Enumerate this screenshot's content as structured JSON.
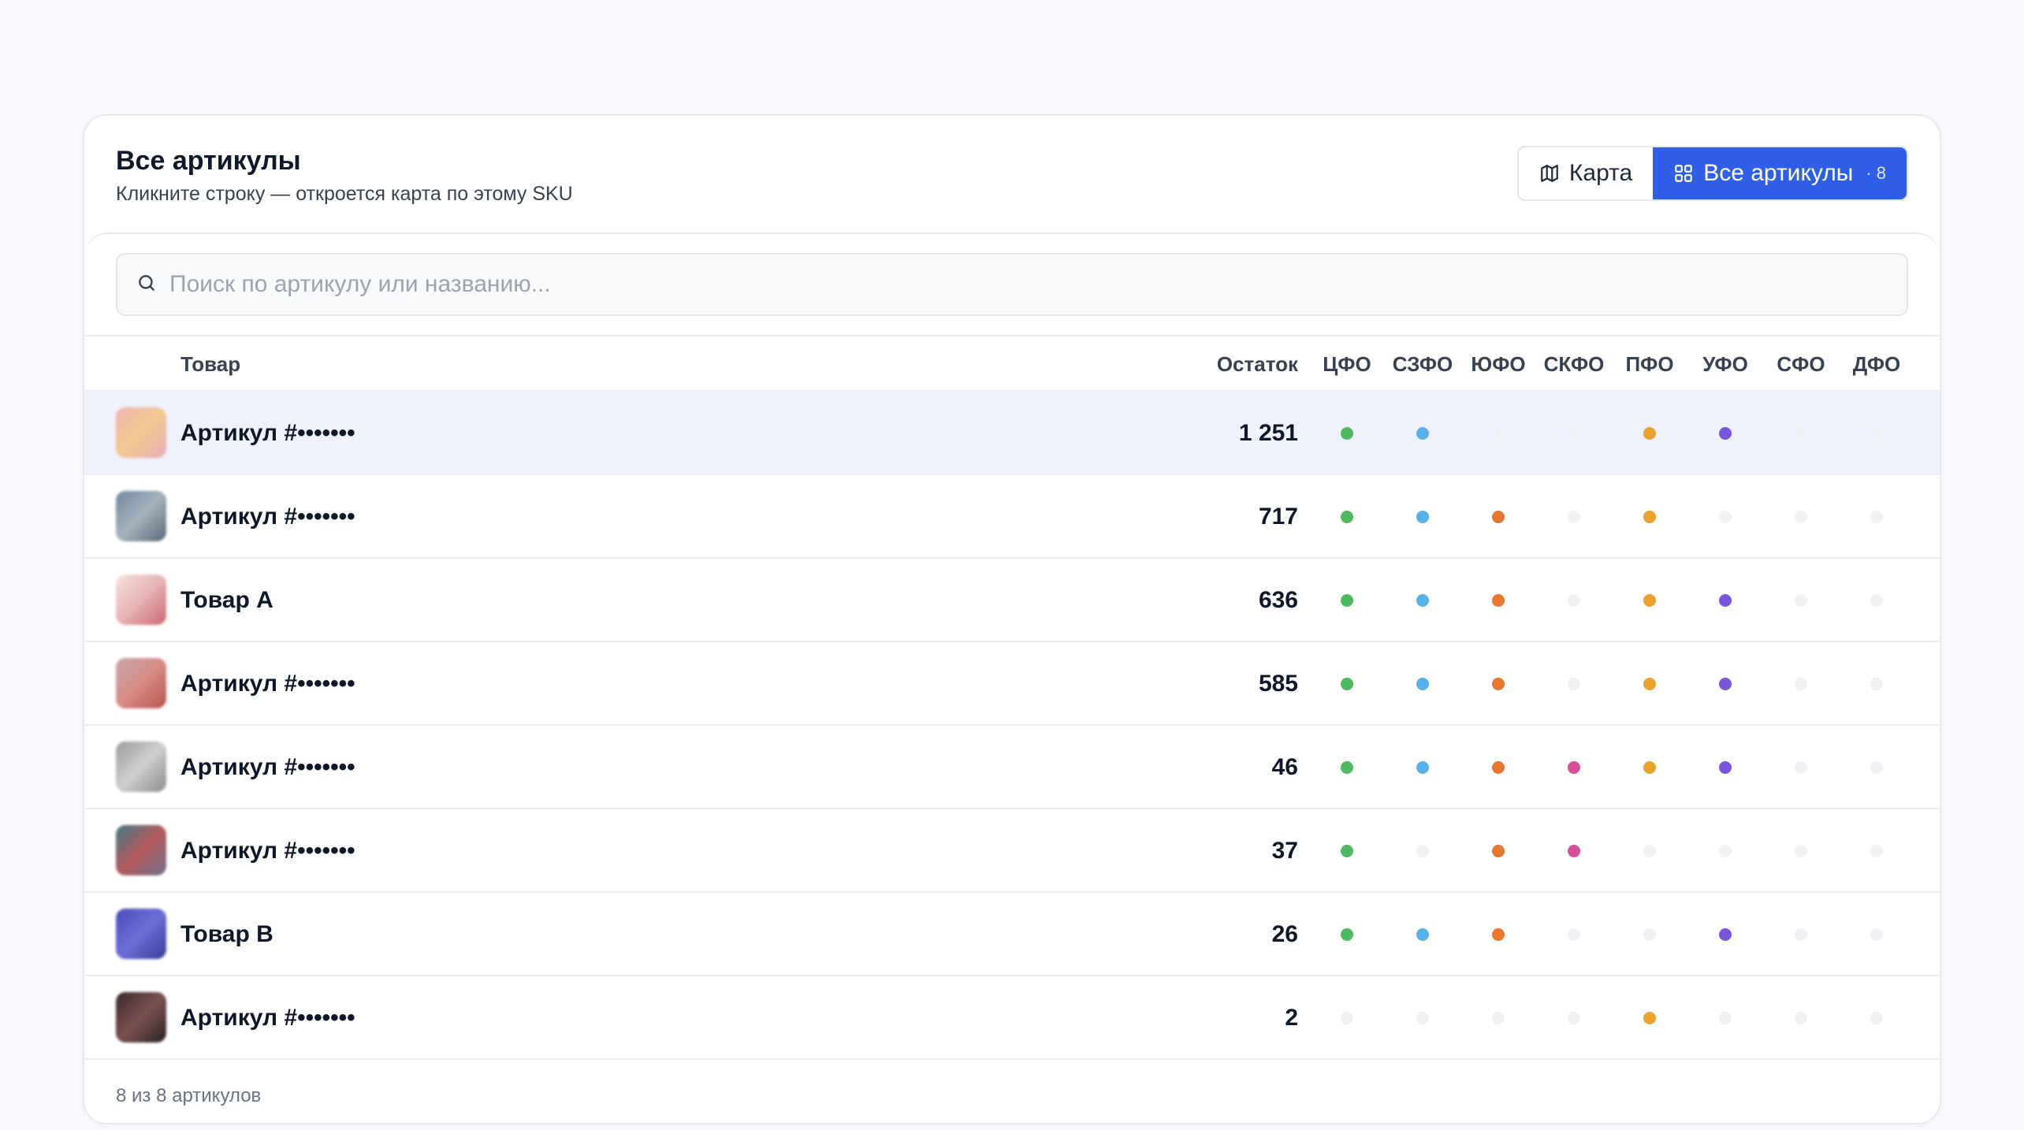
{
  "header": {
    "title": "Все артикулы",
    "subtitle": "Кликните строку — откроется карта по этому SKU"
  },
  "view_toggle": {
    "map_label": "Карта",
    "map_icon": "map-icon",
    "all_label": "Все артикулы",
    "all_icon": "grid-icon",
    "all_count": "· 8",
    "active": "all"
  },
  "search": {
    "placeholder": "Поиск по артикулу или названию...",
    "value": ""
  },
  "table": {
    "columns": {
      "product": "Товар",
      "stock": "Остаток",
      "regions": [
        "ЦФО",
        "СЗФО",
        "ЮФО",
        "СКФО",
        "ПФО",
        "УФО",
        "СФО",
        "ДФО"
      ]
    },
    "region_colors": [
      "#4cbb5e",
      "#56b1ea",
      "#e8762c",
      "#d9509a",
      "#eca22e",
      "#7a56dc",
      "#f0f1f4",
      "#f0f1f4"
    ],
    "inactive_color": "#eef0f3",
    "rows": [
      {
        "name": "Артикул #•••••••",
        "stock": "1 251",
        "regions": [
          1,
          1,
          0,
          0,
          1,
          1,
          0,
          0
        ],
        "selected": true,
        "thumb": [
          "#f0b4b0",
          "#f3c98f",
          "#e7a9b9"
        ]
      },
      {
        "name": "Артикул #•••••••",
        "stock": "717",
        "regions": [
          1,
          1,
          1,
          0,
          1,
          0,
          0,
          0
        ],
        "selected": false,
        "thumb": [
          "#6e8a9e",
          "#a4b2bd",
          "#5a6a78"
        ]
      },
      {
        "name": "Товар А",
        "stock": "636",
        "regions": [
          1,
          1,
          1,
          0,
          1,
          1,
          0,
          0
        ],
        "selected": false,
        "thumb": [
          "#f3e2e0",
          "#e8b3b3",
          "#c9676e"
        ]
      },
      {
        "name": "Артикул #•••••••",
        "stock": "585",
        "regions": [
          1,
          1,
          1,
          0,
          1,
          1,
          0,
          0
        ],
        "selected": false,
        "thumb": [
          "#c7a9a9",
          "#d88b86",
          "#b85650"
        ]
      },
      {
        "name": "Артикул #•••••••",
        "stock": "46",
        "regions": [
          1,
          1,
          1,
          1,
          1,
          1,
          0,
          0
        ],
        "selected": false,
        "thumb": [
          "#9c9c9c",
          "#cfcfcf",
          "#8c8c8c"
        ]
      },
      {
        "name": "Артикул #•••••••",
        "stock": "37",
        "regions": [
          1,
          0,
          1,
          1,
          0,
          0,
          0,
          0
        ],
        "selected": false,
        "thumb": [
          "#3f7a8a",
          "#b45a5a",
          "#6e6e8e"
        ]
      },
      {
        "name": "Товар B",
        "stock": "26",
        "regions": [
          1,
          1,
          1,
          0,
          0,
          1,
          0,
          0
        ],
        "selected": false,
        "thumb": [
          "#4a4eb8",
          "#6a6ed8",
          "#3a3e98"
        ]
      },
      {
        "name": "Артикул #•••••••",
        "stock": "2",
        "regions": [
          0,
          0,
          0,
          0,
          1,
          0,
          0,
          0
        ],
        "selected": false,
        "thumb": [
          "#3a2a2a",
          "#7a5050",
          "#2a2424"
        ]
      }
    ]
  },
  "footer": {
    "summary": "8 из 8 артикулов"
  }
}
